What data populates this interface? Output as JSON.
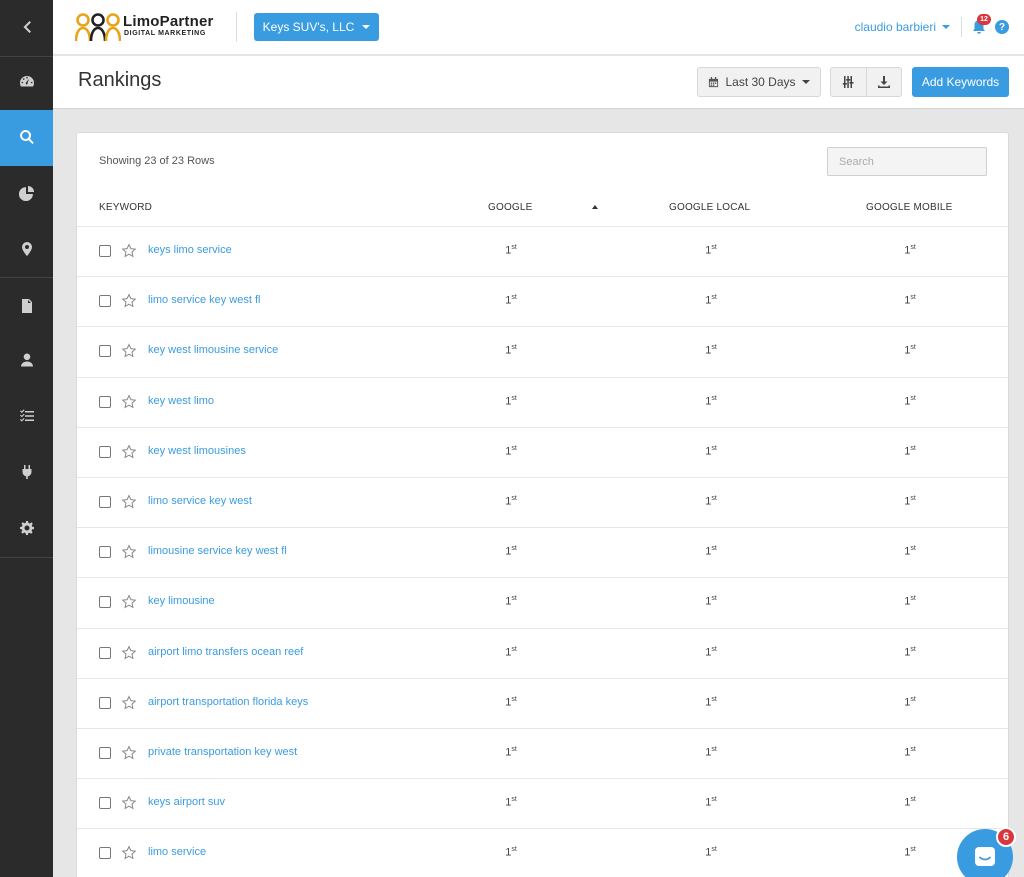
{
  "brand": {
    "name": "LimoPartner",
    "tagline": "DIGITAL MARKETING"
  },
  "client_selector": {
    "label": "Keys SUV's, LLC"
  },
  "user": {
    "name": "claudio barbieri",
    "notifications": "12",
    "help": "?"
  },
  "page": {
    "title": "Rankings",
    "date_range": "Last 30 Days",
    "add_label": "Add Keywords"
  },
  "table": {
    "showing": "Showing 23 of 23 Rows",
    "search_placeholder": "Search",
    "columns": [
      "KEYWORD",
      "GOOGLE",
      "GOOGLE LOCAL",
      "GOOGLE MOBILE"
    ],
    "rank_suffix": "st",
    "rows": [
      {
        "keyword": "keys limo service",
        "google": "1",
        "local": "1",
        "mobile": "1"
      },
      {
        "keyword": "limo service key west fl",
        "google": "1",
        "local": "1",
        "mobile": "1"
      },
      {
        "keyword": "key west limousine service",
        "google": "1",
        "local": "1",
        "mobile": "1"
      },
      {
        "keyword": "key west limo",
        "google": "1",
        "local": "1",
        "mobile": "1"
      },
      {
        "keyword": "key west limousines",
        "google": "1",
        "local": "1",
        "mobile": "1"
      },
      {
        "keyword": "limo service key west",
        "google": "1",
        "local": "1",
        "mobile": "1"
      },
      {
        "keyword": "limousine service key west fl",
        "google": "1",
        "local": "1",
        "mobile": "1"
      },
      {
        "keyword": "key limousine",
        "google": "1",
        "local": "1",
        "mobile": "1"
      },
      {
        "keyword": "airport limo transfers ocean reef",
        "google": "1",
        "local": "1",
        "mobile": "1"
      },
      {
        "keyword": "airport transportation florida keys",
        "google": "1",
        "local": "1",
        "mobile": "1"
      },
      {
        "keyword": "private transportation key west",
        "google": "1",
        "local": "1",
        "mobile": "1"
      },
      {
        "keyword": "keys airport suv",
        "google": "1",
        "local": "1",
        "mobile": "1"
      },
      {
        "keyword": "limo service",
        "google": "1",
        "local": "1",
        "mobile": "1"
      }
    ]
  },
  "chat": {
    "badge": "6"
  },
  "colors": {
    "accent": "#3a9ce0",
    "sidebar": "#2b2b2b",
    "badge": "#d9363e"
  },
  "sidebar": {
    "items": [
      "back-icon",
      "dashboard-icon",
      "search-icon",
      "pie-chart-icon",
      "location-pin-icon",
      "report-icon",
      "user-icon",
      "checklist-icon",
      "plug-icon",
      "gear-icon"
    ],
    "active": "search-icon"
  }
}
